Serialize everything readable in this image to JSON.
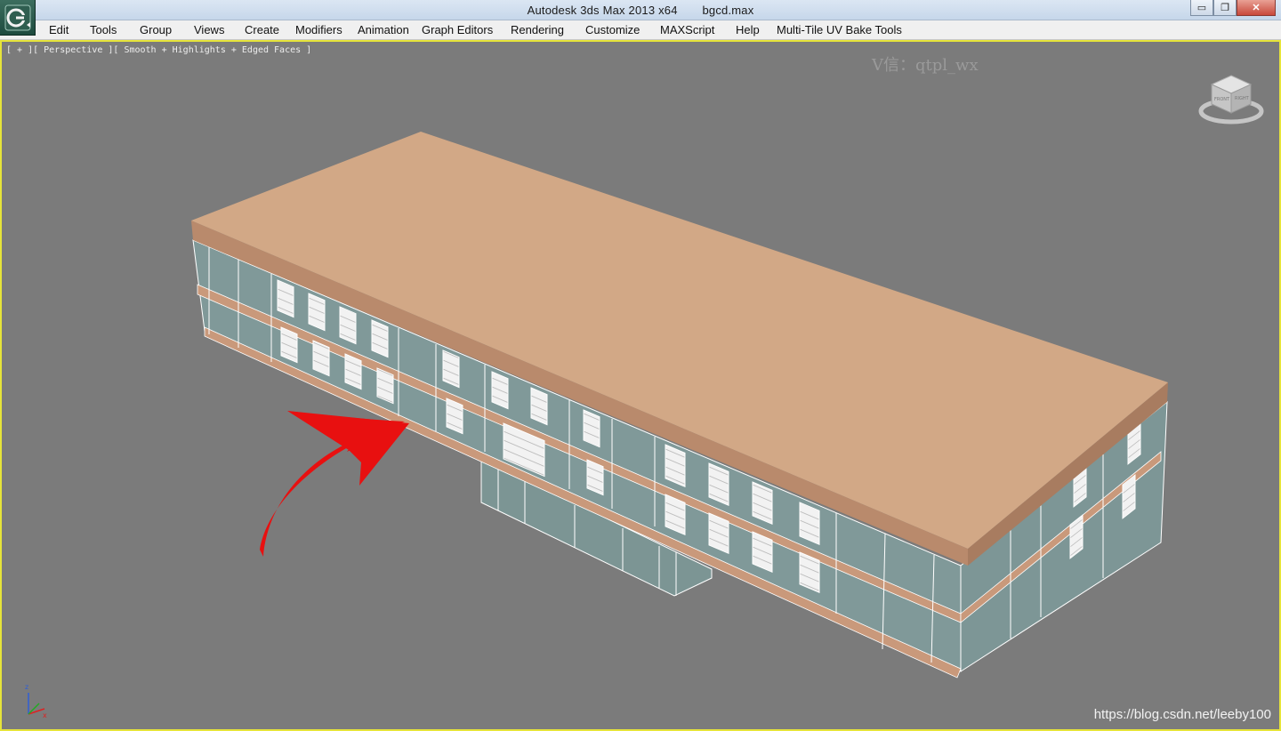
{
  "window": {
    "app_title": "Autodesk 3ds Max  2013 x64",
    "file_name": "bgcd.max",
    "minimize_glyph": "▭",
    "restore_glyph": "❐",
    "close_glyph": "✕"
  },
  "menu": {
    "items": [
      "Edit",
      "Tools",
      "Group",
      "Views",
      "Create",
      "Modifiers",
      "Animation",
      "Graph Editors",
      "Rendering",
      "Customize",
      "MAXScript",
      "Help",
      "Multi-Tile UV Bake Tools"
    ]
  },
  "viewport": {
    "label": "[ + ][ Perspective ][ Smooth + Highlights + Edged Faces ]",
    "watermark_top": "V信：qtpl_wx",
    "watermark_bottom": "https://blog.csdn.net/leeby100",
    "viewcube_faces": [
      "FRONT",
      "RIGHT"
    ],
    "axis_labels": [
      "z",
      "x"
    ]
  },
  "colors": {
    "roof": "#d1a886",
    "roof_side": "#b8896b",
    "wall": "#7f9898",
    "band": "#c8987a",
    "edges": "#ffffff",
    "arrow": "#e81010",
    "selection": "#e6e43a"
  },
  "icons": {
    "app": "3dsmax-logo-icon",
    "viewcube": "viewcube-icon",
    "axis": "axis-tripod-icon",
    "annotation": "red-arrow-icon"
  }
}
